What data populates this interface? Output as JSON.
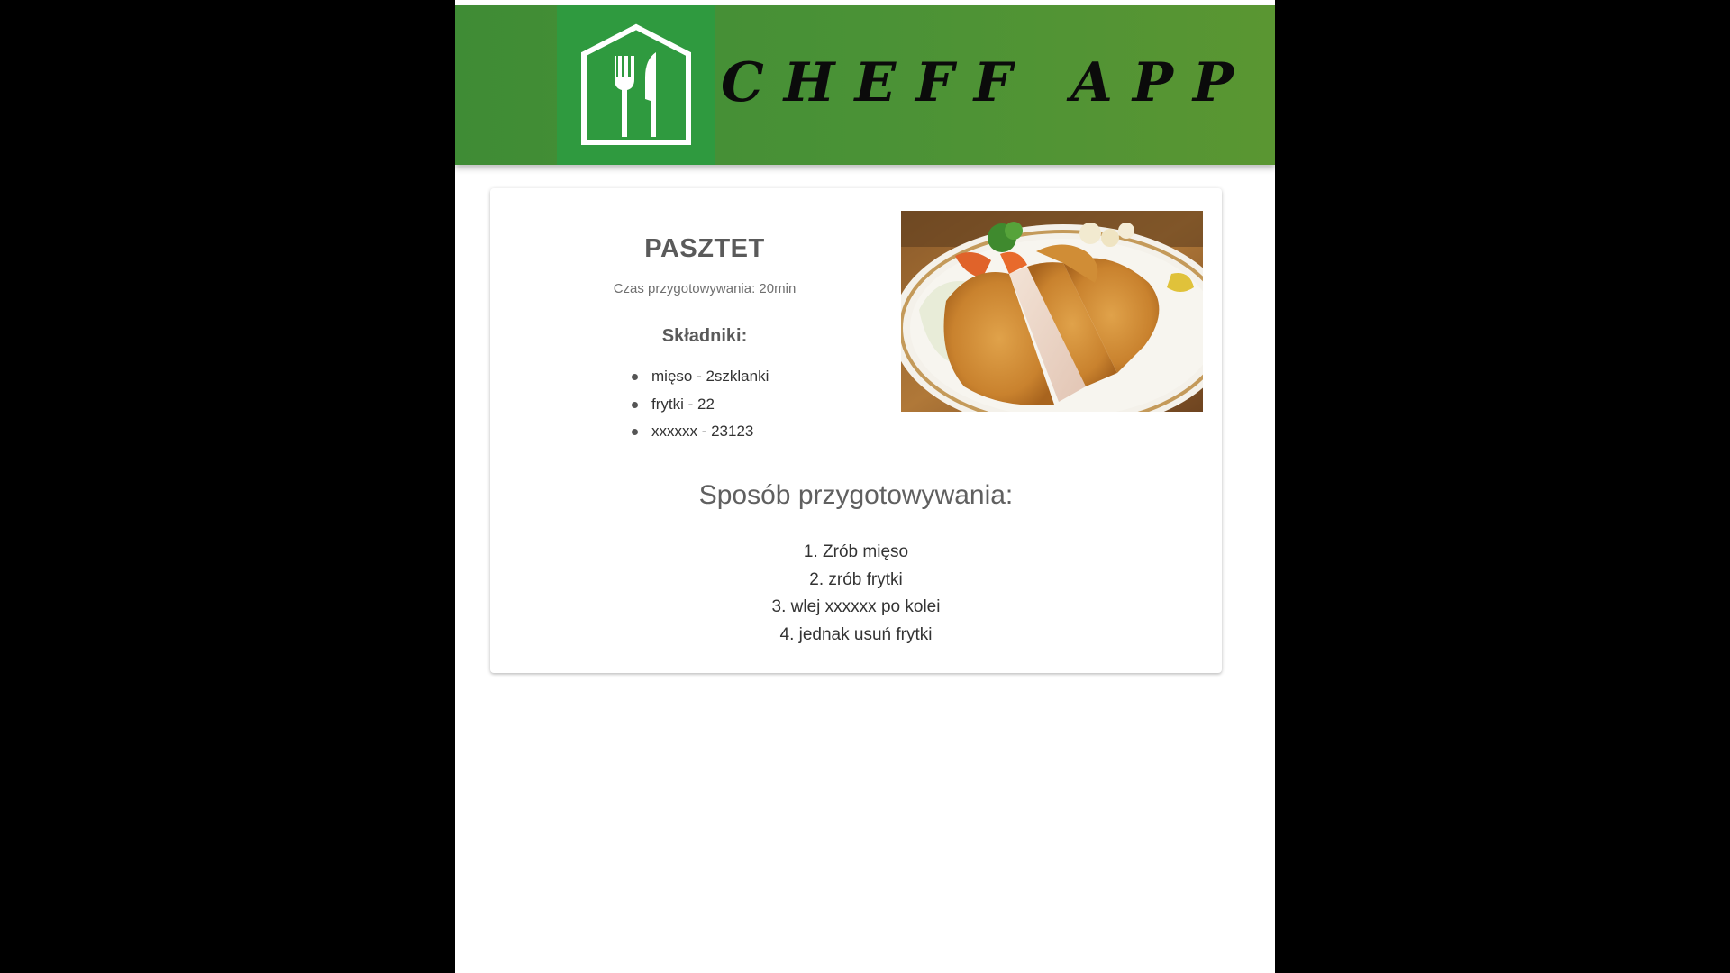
{
  "header": {
    "app_title": "CHEFF APP",
    "logo_icon": "house-fork-knife-icon",
    "colors": {
      "header_green": "#4a9236",
      "logo_green": "#2f9a3f"
    }
  },
  "recipe": {
    "title": "PASZTET",
    "prep_time": "Czas przygotowywania: 20min",
    "ingredients_heading": "Składniki:",
    "ingredients": [
      "mięso - 2szklanki",
      "frytki - 22",
      "xxxxxx - 23123"
    ],
    "photo_icon": "dish-photo",
    "method_heading": "Sposób przygotowywania:",
    "steps": [
      "1. Zrób mięso",
      "2. zrób frytki",
      "3. wlej xxxxxx po kolei",
      "4. jednak usuń frytki"
    ]
  }
}
